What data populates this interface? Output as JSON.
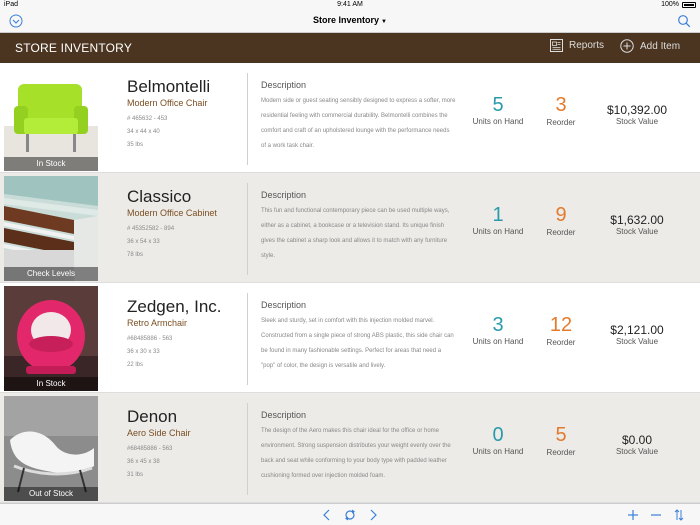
{
  "status_bar": {
    "carrier": "iPad",
    "time": "9:41 AM",
    "battery": "100%"
  },
  "nav": {
    "title": "Store Inventory",
    "left_icon": "chevron-down-circle-icon",
    "right_icon": "search-icon"
  },
  "header": {
    "title": "STORE INVENTORY",
    "reports_label": "Reports",
    "add_label": "Add Item"
  },
  "labels": {
    "description": "Description",
    "units_on_hand": "Units on Hand",
    "reorder": "Reorder",
    "stock_value": "Stock Value"
  },
  "items": [
    {
      "name": "Belmontelli",
      "type": "Modern Office Chair",
      "sku": "# 465632 - 453",
      "dimensions": "34 x 44 x 40",
      "weight": "35 lbs",
      "image_status": "In Stock",
      "description": "Modern side or guest seating sensibly designed to express a softer, more residential feeling with commercial durability. Belmontelli combines the comfort and craft of an upholstered lounge with the performance needs of a work task chair.",
      "units": "5",
      "reorder": "3",
      "value": "$10,392.00"
    },
    {
      "name": "Classico",
      "type": "Modern Office Cabinet",
      "sku": "# 45352582 - 894",
      "dimensions": "36 x 54 x 33",
      "weight": "78 lbs",
      "image_status": "Check Levels",
      "description": "This fun and functional contemporary piece can be used multiple ways, either as a cabinet, a bookcase or a television stand. Its unique finish gives the cabinet a sharp look and allows it to match with any furniture style.",
      "units": "1",
      "reorder": "9",
      "value": "$1,632.00"
    },
    {
      "name": "Zedgen, Inc.",
      "type": "Retro Armchair",
      "sku": "#68485886 - 563",
      "dimensions": "36 x 30  x 33",
      "weight": "22 lbs",
      "image_status": "In Stock",
      "description": "Sleek and sturdy, set in comfort with this injection molded marvel. Constructed from a single piece of strong ABS plastic, this side chair can be found in many fashionable settings. Perfect for areas that need a \"pop\" of color, the design is versatile and lively.",
      "units": "3",
      "reorder": "12",
      "value": "$2,121.00"
    },
    {
      "name": "Denon",
      "type": "Aero Side Chair",
      "sku": "#68485886 - 563",
      "dimensions": "36 x 45  x 38",
      "weight": "31 lbs",
      "image_status": "Out of Stock",
      "description": "The design of the Aero makes this chair ideal for the office or home environment. Strong suspension distributes your weight evenly over the back and seat while conforming to your body type with padded leather cushioning formed over injection molded foam.",
      "units": "0",
      "reorder": "5",
      "value": "$0.00"
    }
  ],
  "toolbar": {
    "icons": [
      "chevron-left-icon",
      "refresh-icon",
      "chevron-right-icon",
      "plus-icon",
      "minus-icon",
      "sort-icon"
    ]
  },
  "colors": {
    "header_bg": "#4b3520",
    "accent_blue": "#2a9bab",
    "accent_orange": "#e47b2c",
    "type_brown": "#7a4e22",
    "ios_blue": "#3b7fd8"
  }
}
